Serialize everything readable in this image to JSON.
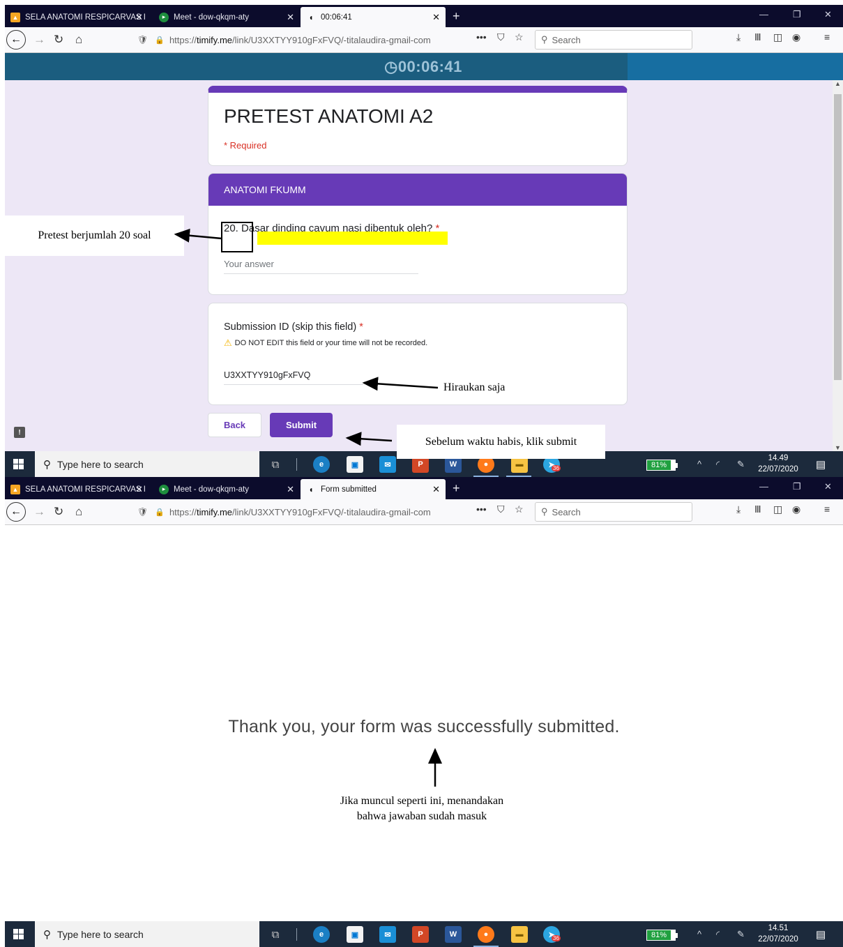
{
  "tabs": {
    "tab1_label": "SELA ANATOMI RESPICARVAS I",
    "tab2_label": "Meet - dow-qkqm-aty",
    "tab3_label_a": "00:06:41",
    "tab3_label_b": "Form submitted",
    "close_glyph": "✕",
    "new_tab": "+"
  },
  "window_controls": {
    "minimize": "—",
    "restore": "❐",
    "close": "✕"
  },
  "nav": {
    "url_prefix": "https://",
    "url_domain": "timify.me",
    "url_path": "/link/U3XXTYY910gFxFVQ/-titalaudira-gmail-com",
    "search_placeholder": "Search"
  },
  "timer": {
    "value": "00:06:41",
    "icon": "clock-icon"
  },
  "form": {
    "title": "PRETEST ANATOMI A2",
    "required_note": "* Required",
    "section_header": "ANATOMI FKUMM",
    "question": "20. Dasar dinding cavum nasi dibentuk oleh?",
    "question_star": "*",
    "answer_placeholder": "Your answer",
    "submission_label": "Submission ID (skip this field)",
    "submission_star": "*",
    "warning_text": "DO NOT EDIT this field or your time will not be recorded.",
    "submission_value": "U3XXTYY910gFxFVQ",
    "back_label": "Back",
    "submit_label": "Submit"
  },
  "annotations": {
    "pretest_count": "Pretest berjumlah 20 soal",
    "ignore": "Hiraukan saja",
    "submit_hint": "Sebelum waktu habis, klik submit",
    "success_hint_line1": "Jika muncul seperti ini, menandakan",
    "success_hint_line2": "bahwa jawaban sudah masuk"
  },
  "result": {
    "message": "Thank you, your form was successfully submitted."
  },
  "taskbar": {
    "search_placeholder": "Type here to search",
    "battery": "81%",
    "time_a": "14.49",
    "date_a": "22/07/2020",
    "time_b": "14.51",
    "date_b": "22/07/2020",
    "telegram_badge": "36",
    "notif_count": "6"
  },
  "colors": {
    "form_accent": "#673ab7",
    "timer_bg": "#1b5d7f",
    "highlight": "#ffff00",
    "required": "#d93025"
  }
}
